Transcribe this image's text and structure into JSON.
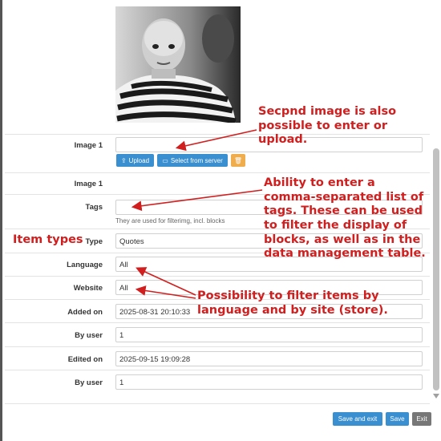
{
  "form": {
    "image1_label": "Image 1",
    "upload_label": "Upload",
    "select_server_label": "Select from server",
    "image1_b_label": "Image 1",
    "tags_label": "Tags",
    "tags_value": "",
    "tags_hint": "They are used for filterimg, incl. blocks",
    "type_label": "Type",
    "type_value": "Quotes",
    "language_label": "Language",
    "language_value": "All",
    "website_label": "Website",
    "website_value": "All",
    "added_on_label": "Added on",
    "added_on_value": "2025-08-31 20:10:33",
    "by_user_label": "By user",
    "by_user_value": "1",
    "edited_on_label": "Edited on",
    "edited_on_value": "2025-09-15 19:09:28",
    "by_user2_label": "By user",
    "by_user2_value": "1"
  },
  "footer": {
    "save_exit_label": "Save and exit",
    "save_label": "Save",
    "exit_label": "Exit"
  },
  "annotations": {
    "second_image": [
      "Secpnd image is also",
      "possible to enter or",
      "upload."
    ],
    "tags": [
      "Ability to enter a",
      "comma-separated list of",
      "tags. These can be used",
      "to filter the display of",
      "blocks, as well as in the",
      "data management table."
    ],
    "item_types": "Item types",
    "filter": [
      "Possibility to filter items by",
      "language and by site (store)."
    ]
  },
  "colors": {
    "accent_blue": "#3a8fd0",
    "delete_orange": "#f0ad4e",
    "exit_grey": "#777777",
    "annotation_red": "#d11f1f"
  },
  "icons": {
    "upload": "upload-icon",
    "folder": "folder-icon",
    "trash": "trash-icon"
  }
}
